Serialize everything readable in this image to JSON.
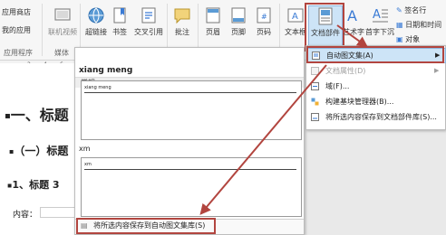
{
  "ribbon": {
    "left_group": {
      "app_store": "应用商店",
      "my_apps": "我的应用",
      "label": "应用程序"
    },
    "online_video": "联机视频",
    "media_label": "媒体",
    "hyperlink": "超链接",
    "bookmark": "书签",
    "cross_ref": "交叉引用",
    "comment": "批注",
    "header": "页眉",
    "footer": "页脚",
    "page_number": "页码",
    "textbox": "文本框",
    "doc_parts": "文档部件",
    "wordart": "艺术字",
    "dropcap": "首字下沉",
    "signature_line": "签名行",
    "date_time": "日期和时间",
    "object": "对象"
  },
  "ruler": [
    "2",
    "4",
    "6"
  ],
  "document": {
    "h1": "一、标题",
    "h2": "（一）标题",
    "h3": "1、标题 3",
    "content_label": "内容："
  },
  "gallery": {
    "author": "xiang meng",
    "section": "常规",
    "thumb1_text": "xiang meng",
    "thumb2_label": "xm",
    "thumb2_text": "xm",
    "footer_action": "将所选内容保存到自动图文集库(S)"
  },
  "menu": {
    "items": [
      {
        "label": "自动图文集(A)"
      },
      {
        "label": "文档属性(D)"
      },
      {
        "label": "域(F)..."
      },
      {
        "label": "构建基块管理器(B)..."
      },
      {
        "label": "将所选内容保存到文档部件库(S)..."
      }
    ]
  }
}
